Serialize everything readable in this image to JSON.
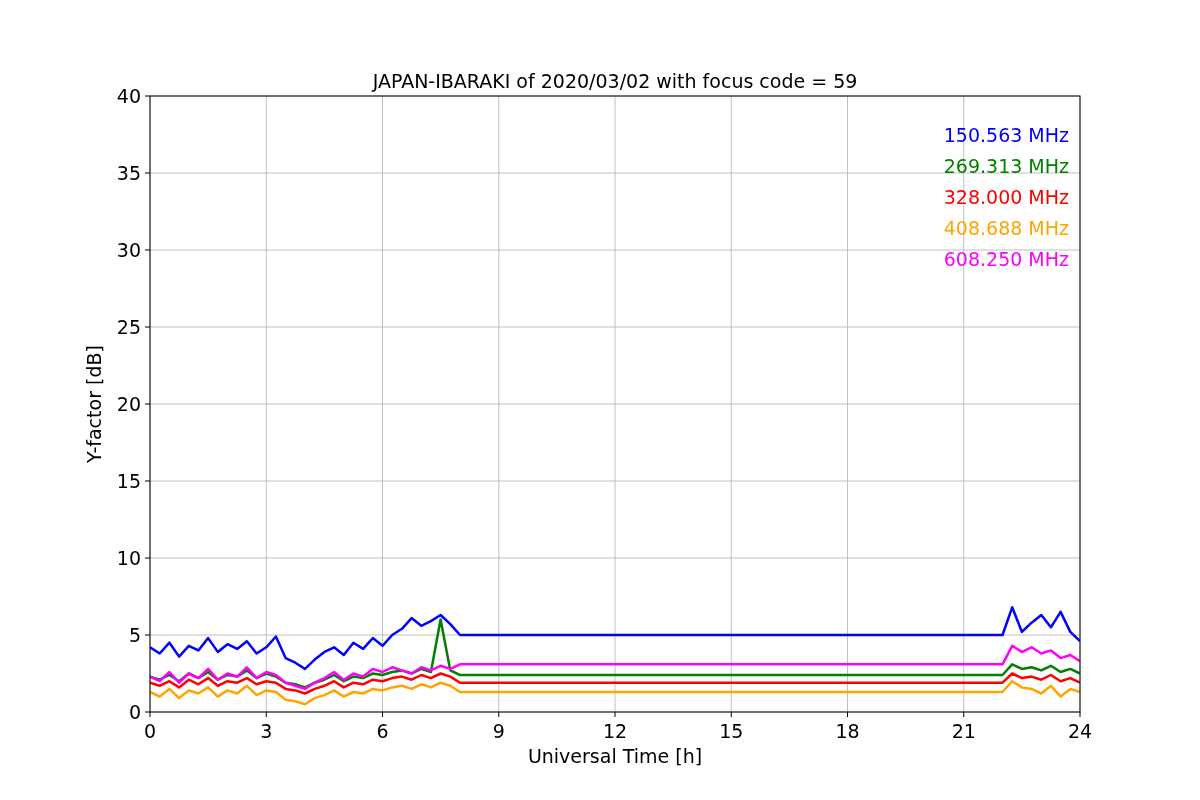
{
  "figure": {
    "chart_data": {
      "type": "line",
      "title": "JAPAN-IBARAKI of 2020/03/02 with focus code = 59",
      "xlabel": "Universal Time [h]",
      "ylabel": "Y-factor [dB]",
      "xlim": [
        0,
        24
      ],
      "ylim": [
        0,
        40
      ],
      "xticks": [
        0,
        3,
        6,
        9,
        12,
        15,
        18,
        21,
        24
      ],
      "yticks": [
        0,
        5,
        10,
        15,
        20,
        25,
        30,
        35,
        40
      ],
      "grid": true,
      "x": [
        0,
        0.25,
        0.5,
        0.75,
        1,
        1.25,
        1.5,
        1.75,
        2,
        2.25,
        2.5,
        2.75,
        3,
        3.25,
        3.5,
        3.75,
        4,
        4.25,
        4.5,
        4.75,
        5,
        5.25,
        5.5,
        5.75,
        6,
        6.25,
        6.5,
        6.75,
        7,
        7.25,
        7.5,
        7.75,
        8,
        22,
        22.25,
        22.5,
        22.75,
        23,
        23.25,
        23.5,
        23.75,
        24
      ],
      "series": [
        {
          "name": "150.563 MHz",
          "color": "#0000ff",
          "values": [
            4.2,
            3.8,
            4.5,
            3.6,
            4.3,
            4.0,
            4.8,
            3.9,
            4.4,
            4.1,
            4.6,
            3.8,
            4.2,
            4.9,
            3.5,
            3.2,
            2.8,
            3.4,
            3.9,
            4.2,
            3.7,
            4.5,
            4.1,
            4.8,
            4.3,
            5.0,
            5.4,
            6.1,
            5.6,
            5.9,
            6.3,
            5.7,
            5.0,
            5.0,
            6.8,
            5.2,
            5.8,
            6.3,
            5.5,
            6.5,
            5.2,
            4.6
          ]
        },
        {
          "name": "269.313 MHz",
          "color": "#008000",
          "values": [
            2.3,
            2.1,
            2.4,
            2.0,
            2.5,
            2.2,
            2.6,
            2.1,
            2.4,
            2.3,
            2.7,
            2.2,
            2.5,
            2.3,
            1.9,
            1.8,
            1.6,
            1.9,
            2.1,
            2.4,
            2.0,
            2.3,
            2.2,
            2.5,
            2.4,
            2.6,
            2.7,
            2.5,
            2.8,
            2.6,
            6.0,
            2.7,
            2.4,
            2.4,
            3.1,
            2.8,
            2.9,
            2.7,
            3.0,
            2.6,
            2.8,
            2.5
          ]
        },
        {
          "name": "328.000 MHz",
          "color": "#ff0000",
          "values": [
            1.9,
            1.7,
            2.0,
            1.6,
            2.1,
            1.8,
            2.2,
            1.7,
            2.0,
            1.9,
            2.2,
            1.8,
            2.0,
            1.9,
            1.5,
            1.4,
            1.2,
            1.5,
            1.7,
            2.0,
            1.6,
            1.9,
            1.8,
            2.1,
            2.0,
            2.2,
            2.3,
            2.1,
            2.4,
            2.2,
            2.5,
            2.3,
            1.9,
            1.9,
            2.5,
            2.2,
            2.3,
            2.1,
            2.4,
            2.0,
            2.2,
            1.9
          ]
        },
        {
          "name": "408.688 MHz",
          "color": "#ffa500",
          "values": [
            1.3,
            1.0,
            1.5,
            0.9,
            1.4,
            1.2,
            1.6,
            1.0,
            1.4,
            1.2,
            1.7,
            1.1,
            1.4,
            1.3,
            0.8,
            0.7,
            0.5,
            0.9,
            1.1,
            1.4,
            1.0,
            1.3,
            1.2,
            1.5,
            1.4,
            1.6,
            1.7,
            1.5,
            1.8,
            1.6,
            1.9,
            1.7,
            1.3,
            1.3,
            2.0,
            1.6,
            1.5,
            1.2,
            1.7,
            1.0,
            1.5,
            1.3
          ]
        },
        {
          "name": "608.250 MHz",
          "color": "#ff00ff",
          "values": [
            2.3,
            2.0,
            2.6,
            1.9,
            2.5,
            2.2,
            2.8,
            2.1,
            2.5,
            2.3,
            2.9,
            2.2,
            2.6,
            2.4,
            1.9,
            1.7,
            1.5,
            1.9,
            2.2,
            2.6,
            2.1,
            2.5,
            2.3,
            2.8,
            2.6,
            2.9,
            2.7,
            2.5,
            2.9,
            2.7,
            3.0,
            2.8,
            3.1,
            3.1,
            4.3,
            3.9,
            4.2,
            3.8,
            4.0,
            3.5,
            3.7,
            3.3
          ]
        }
      ]
    }
  }
}
